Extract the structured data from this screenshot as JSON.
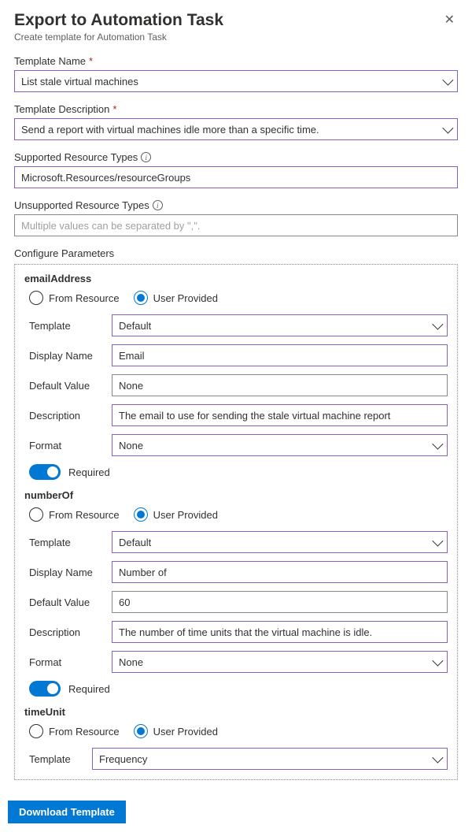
{
  "header": {
    "title": "Export to Automation Task",
    "subtitle": "Create template for Automation Task"
  },
  "fields": {
    "templateName": {
      "label": "Template Name",
      "value": "List stale virtual machines"
    },
    "templateDescription": {
      "label": "Template Description",
      "value": "Send a report with virtual machines idle more than a specific time."
    },
    "supportedTypes": {
      "label": "Supported Resource Types",
      "value": "Microsoft.Resources/resourceGroups"
    },
    "unsupportedTypes": {
      "label": "Unsupported Resource Types",
      "placeholder": "Multiple values can be separated by \",\"."
    }
  },
  "configureLabel": "Configure Parameters",
  "radioLabels": {
    "fromResource": "From Resource",
    "userProvided": "User Provided"
  },
  "rowLabels": {
    "template": "Template",
    "displayName": "Display Name",
    "defaultValue": "Default Value",
    "description": "Description",
    "format": "Format",
    "required": "Required"
  },
  "params": {
    "emailAddress": {
      "name": "emailAddress",
      "template": "Default",
      "displayName": "Email",
      "defaultValue": "None",
      "description": "The email to use for sending the stale virtual machine report",
      "format": "None"
    },
    "numberOf": {
      "name": "numberOf",
      "template": "Default",
      "displayName": "Number of",
      "defaultValue": "60",
      "description": "The number of time units that the virtual machine is idle.",
      "format": "None"
    },
    "timeUnit": {
      "name": "timeUnit",
      "template": "Frequency"
    }
  },
  "footer": {
    "download": "Download Template"
  }
}
